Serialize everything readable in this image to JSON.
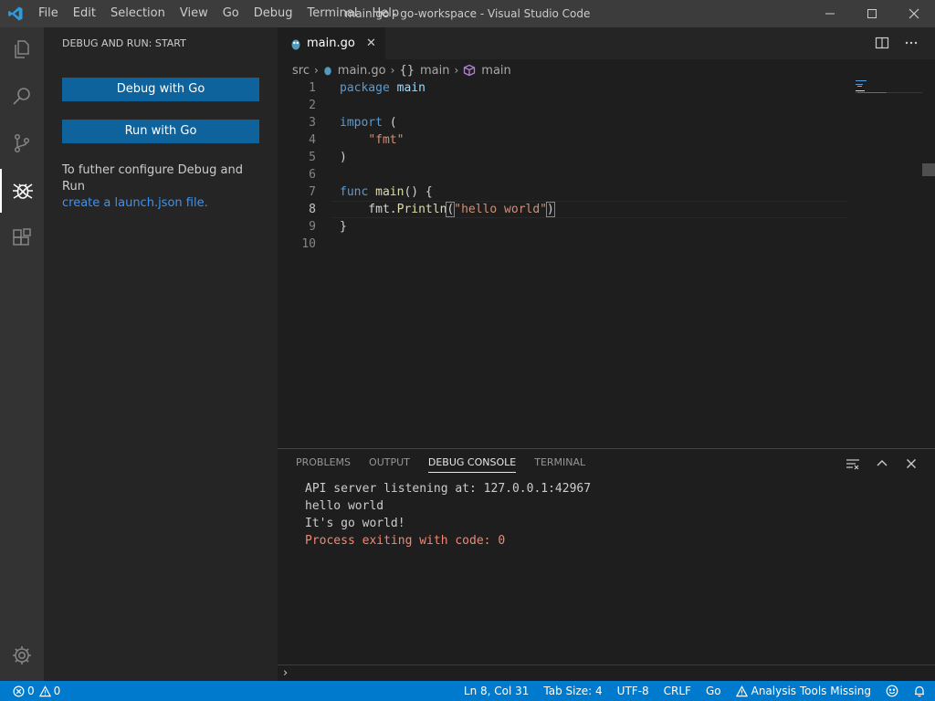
{
  "window": {
    "title": "main.go - go-workspace - Visual Studio Code",
    "menu": [
      "File",
      "Edit",
      "Selection",
      "View",
      "Go",
      "Debug",
      "Terminal",
      "Help"
    ]
  },
  "activity_bar": {
    "items": [
      "explorer-icon",
      "search-icon",
      "source-control-icon",
      "debug-icon",
      "extensions-icon"
    ],
    "active": "debug-icon",
    "bottom": "gear-icon"
  },
  "sidebar": {
    "title": "DEBUG AND RUN: START",
    "debug_button": "Debug with Go",
    "run_button": "Run with Go",
    "help_text": "To futher configure Debug and Run",
    "link_text": "create a launch.json file."
  },
  "editor": {
    "tab_label": "main.go",
    "tab_close": "✕",
    "breadcrumbs": [
      "src",
      "main.go",
      "main",
      "main"
    ],
    "bc_brace": "{}",
    "lines": [
      {
        "n": "1",
        "tokens": [
          [
            "kw",
            "package"
          ],
          [
            "",
            "",
            " "
          ],
          [
            "id",
            "main"
          ]
        ]
      },
      {
        "n": "2",
        "tokens": []
      },
      {
        "n": "3",
        "tokens": [
          [
            "kw",
            "import"
          ],
          [
            "",
            " ("
          ]
        ]
      },
      {
        "n": "4",
        "tokens": [
          [
            "",
            "    "
          ],
          [
            "str",
            "\"fmt\""
          ]
        ]
      },
      {
        "n": "5",
        "tokens": [
          [
            "",
            ")"
          ]
        ]
      },
      {
        "n": "6",
        "tokens": []
      },
      {
        "n": "7",
        "tokens": [
          [
            "kw",
            "func"
          ],
          [
            "",
            " "
          ],
          [
            "fn",
            "main"
          ],
          [
            "",
            "() {"
          ]
        ]
      },
      {
        "n": "8",
        "tokens": [
          [
            "",
            "    fmt."
          ],
          [
            "fn",
            "Println"
          ],
          [
            "bracket",
            "("
          ],
          [
            "str",
            "\"hello world\""
          ],
          [
            "bracket",
            ")"
          ]
        ]
      },
      {
        "n": "9",
        "tokens": [
          [
            "",
            "}"
          ]
        ]
      },
      {
        "n": "10",
        "tokens": []
      }
    ]
  },
  "panel": {
    "tabs": [
      "PROBLEMS",
      "OUTPUT",
      "DEBUG CONSOLE",
      "TERMINAL"
    ],
    "active_tab": "DEBUG CONSOLE",
    "console": [
      {
        "text": "API server listening at: 127.0.0.1:42967",
        "type": "info"
      },
      {
        "text": "hello world",
        "type": "info"
      },
      {
        "text": "It's go world!",
        "type": "info"
      },
      {
        "text": "Process exiting with code: 0",
        "type": "error"
      }
    ],
    "repl_prompt": "›"
  },
  "status_bar": {
    "errors": "0",
    "warnings": "0",
    "position": "Ln 8, Col 31",
    "tab_size": "Tab Size: 4",
    "encoding": "UTF-8",
    "eol": "CRLF",
    "language": "Go",
    "analysis": "Analysis Tools Missing"
  },
  "colors": {
    "accent": "#007acc",
    "button": "#0e639c",
    "link": "#3794ff",
    "error_text": "#f48771"
  }
}
